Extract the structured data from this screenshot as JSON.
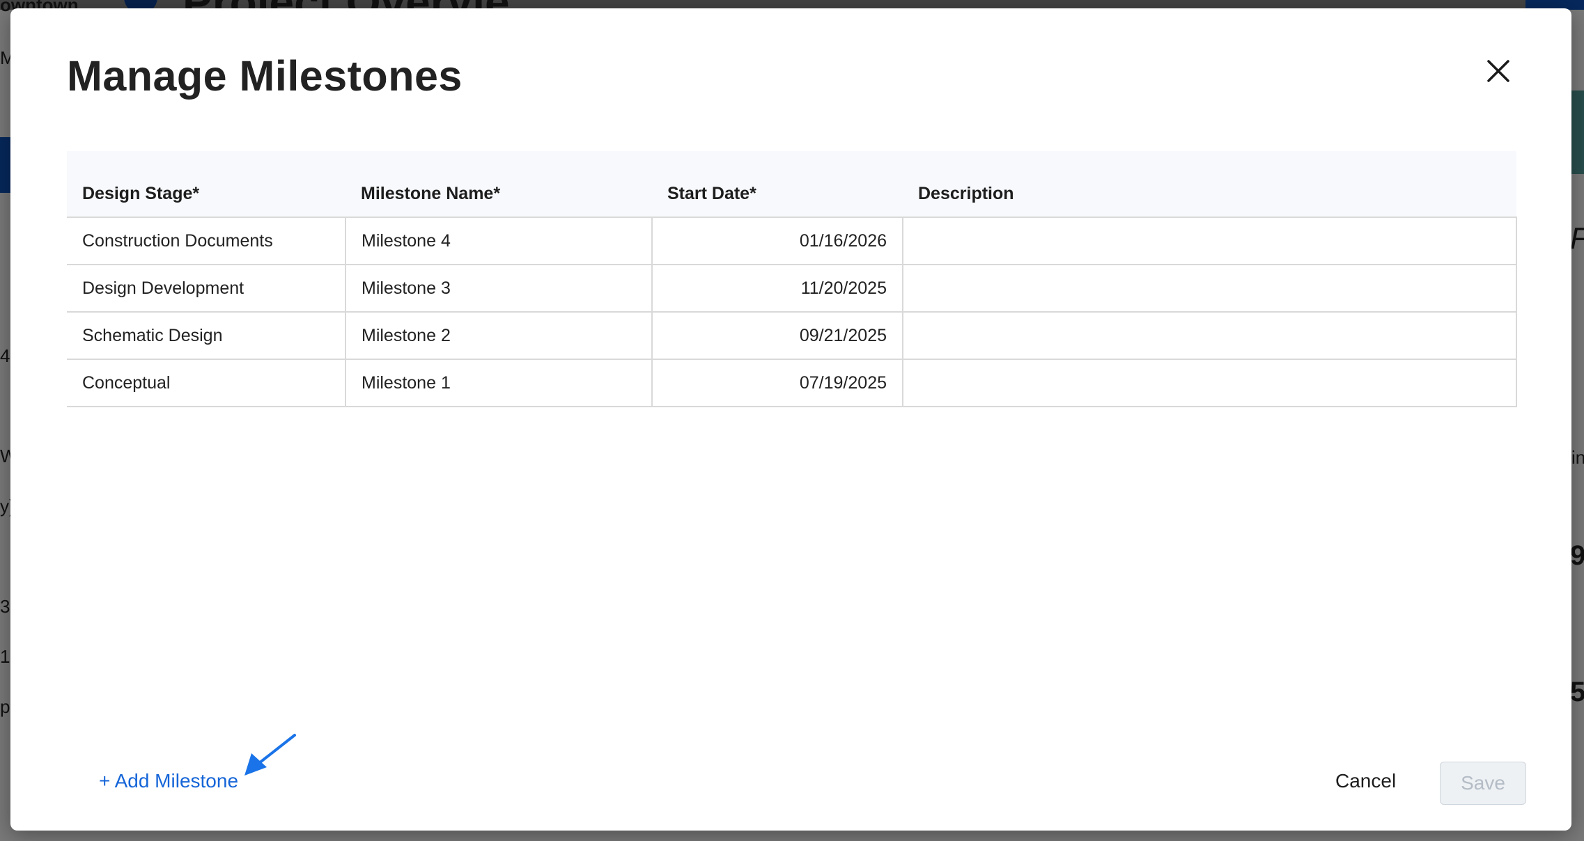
{
  "background": {
    "title_fragment": "Project Overvie",
    "top_left_text": "owntown",
    "side_fragments": [
      "M",
      "4",
      "W",
      "y)",
      "3",
      "1",
      "pa"
    ],
    "right_fragments": [
      "F",
      "in",
      "9",
      "5"
    ]
  },
  "modal": {
    "title": "Manage Milestones",
    "close_icon": "close-icon",
    "table": {
      "headers": [
        "Design Stage*",
        "Milestone Name*",
        "Start Date*",
        "Description"
      ],
      "rows": [
        {
          "stage": "Construction Documents",
          "name": "Milestone 4",
          "date": "01/16/2026",
          "description": ""
        },
        {
          "stage": "Design Development",
          "name": "Milestone 3",
          "date": "11/20/2025",
          "description": ""
        },
        {
          "stage": "Schematic Design",
          "name": "Milestone 2",
          "date": "09/21/2025",
          "description": ""
        },
        {
          "stage": "Conceptual",
          "name": "Milestone 1",
          "date": "07/19/2025",
          "description": ""
        }
      ]
    },
    "add_milestone_label": "+ Add Milestone",
    "cancel_label": "Cancel",
    "save_label": "Save"
  },
  "colors": {
    "link": "#1565d8",
    "arrow": "#1a73e8",
    "save_disabled_text": "#b4bcc6"
  }
}
